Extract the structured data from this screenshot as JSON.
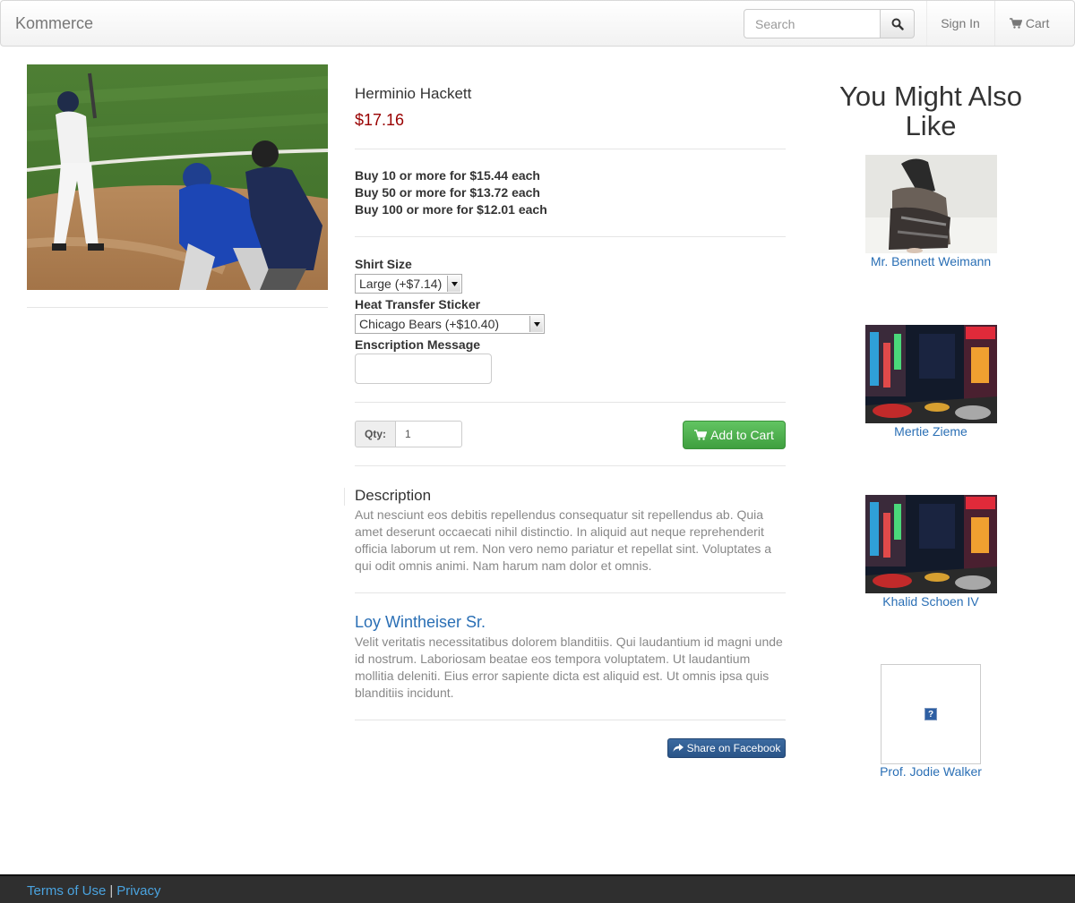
{
  "navbar": {
    "brand": "Kommerce",
    "search_placeholder": "Search",
    "sign_in": "Sign In",
    "cart": "Cart"
  },
  "product": {
    "name": "Herminio Hackett",
    "price": "$17.16",
    "tiers": [
      "Buy 10 or more for $15.44 each",
      "Buy 50 or more for $13.72 each",
      "Buy 100 or more for $12.01 each"
    ],
    "options": {
      "shirt_size_label": "Shirt Size",
      "shirt_size_value": "Large (+$7.14)",
      "sticker_label": "Heat Transfer Sticker",
      "sticker_value": "Chicago Bears (+$10.40)",
      "message_label": "Enscription Message"
    },
    "qty_label": "Qty:",
    "qty_value": "1",
    "add_to_cart": "Add to Cart"
  },
  "description": {
    "title": "Description",
    "text": "Aut nesciunt eos debitis repellendus consequatur sit repellendus ab. Quia amet deserunt occaecati nihil distinctio. In aliquid aut neque reprehenderit officia laborum ut rem. Non vero nemo pariatur et repellat sint. Voluptates a qui odit omnis animi. Nam harum nam dolor et omnis."
  },
  "review": {
    "author": "Loy Wintheiser Sr.",
    "text": "Velit veritatis necessitatibus dolorem blanditiis. Qui laudantium id magni unde id nostrum. Laboriosam beatae eos tempora voluptatem. Ut laudantium mollitia deleniti. Eius error sapiente dicta est aliquid est. Ut omnis ipsa quis blanditiis incidunt."
  },
  "share": {
    "facebook": "Share on Facebook"
  },
  "recommendations": {
    "heading": "You Might Also Like",
    "items": [
      {
        "name": "Mr. Bennett Weimann"
      },
      {
        "name": "Mertie Zieme"
      },
      {
        "name": "Khalid Schoen IV"
      },
      {
        "name": "Prof. Jodie Walker"
      }
    ],
    "broken_image_glyph": "?"
  },
  "footer": {
    "terms": "Terms of Use",
    "separator": "|",
    "privacy": "Privacy"
  },
  "colors": {
    "price": "#990000",
    "link": "#2a6fb5",
    "add_to_cart": "#47a447",
    "facebook": "#2a5488",
    "footer_bg": "#2f2f2f"
  }
}
